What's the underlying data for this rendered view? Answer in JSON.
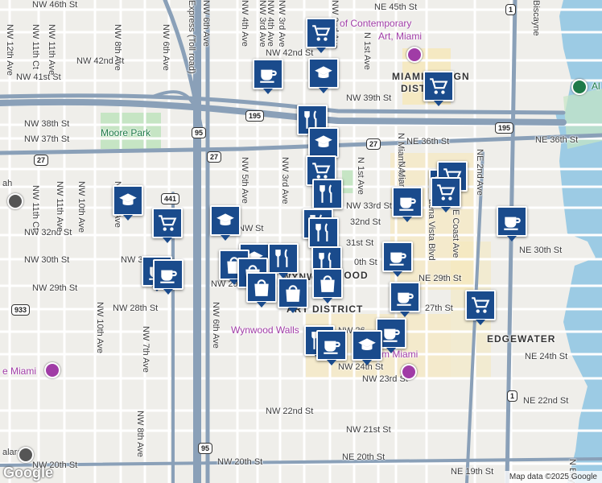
{
  "map": {
    "attribution": "Map data ©2025 Google",
    "logo": "Google",
    "labels": [
      {
        "id": "nw46",
        "text": "NW 46th St"
      },
      {
        "id": "nw42",
        "text": "NW 42nd St"
      },
      {
        "id": "nw41",
        "text": "NW 41st St"
      },
      {
        "id": "nw42b",
        "text": "NW 42nd St"
      },
      {
        "id": "nw38",
        "text": "NW 38th St"
      },
      {
        "id": "nw37",
        "text": "NW 37th St"
      },
      {
        "id": "nw39",
        "text": "NW 39th St"
      },
      {
        "id": "ne45",
        "text": "NE 45th St"
      },
      {
        "id": "ne36a",
        "text": "NE 36th St"
      },
      {
        "id": "ne36b",
        "text": "NE 36th St"
      },
      {
        "id": "nw32",
        "text": "NW 32nd St"
      },
      {
        "id": "nw30",
        "text": "NW 30th St"
      },
      {
        "id": "nw30b",
        "text": "NW 30"
      },
      {
        "id": "nw29",
        "text": "NW 29th St"
      },
      {
        "id": "nw29b",
        "text": "NW 29"
      },
      {
        "id": "nw28",
        "text": "NW 28th St"
      },
      {
        "id": "nw33",
        "text": "NW 33rd St"
      },
      {
        "id": "n32",
        "text": "32nd St"
      },
      {
        "id": "n31",
        "text": "31st St"
      },
      {
        "id": "n30",
        "text": "0th St"
      },
      {
        "id": "ne30",
        "text": "NE 30th St"
      },
      {
        "id": "ne29",
        "text": "NE 29th St"
      },
      {
        "id": "n27",
        "text": "27th St"
      },
      {
        "id": "ne24",
        "text": "NE 24th St"
      },
      {
        "id": "ne22",
        "text": "NE 22nd St"
      },
      {
        "id": "nw24",
        "text": "NW 24th St"
      },
      {
        "id": "nw23",
        "text": "NW 23rd St"
      },
      {
        "id": "nw22",
        "text": "NW 22nd St"
      },
      {
        "id": "nw21",
        "text": "NW 21st St"
      },
      {
        "id": "nw20",
        "text": "NW 20th St"
      },
      {
        "id": "nw20b",
        "text": "NW 20th St"
      },
      {
        "id": "ne20",
        "text": "NE 20th St"
      },
      {
        "id": "ne19",
        "text": "NE 19th St"
      },
      {
        "id": "nw26",
        "text": "NW 26"
      },
      {
        "id": "nwst",
        "text": "NW"
      },
      {
        "id": "nwst2",
        "text": "St"
      },
      {
        "id": "nw12",
        "text": "NW 12th Ave"
      },
      {
        "id": "nw11",
        "text": "NW 11th Ave"
      },
      {
        "id": "nw11ct",
        "text": "NW 11th Ct"
      },
      {
        "id": "nw11ct2",
        "text": "NW 11th Ct"
      },
      {
        "id": "nw11b",
        "text": "NW 11th Ave"
      },
      {
        "id": "nw10",
        "text": "NW 10th Ave"
      },
      {
        "id": "nw10b",
        "text": "NW 10th Ave"
      },
      {
        "id": "nw8",
        "text": "NW 8th Ave"
      },
      {
        "id": "nw8b",
        "text": "NW 8th Ave"
      },
      {
        "id": "nw8c",
        "text": "NW 8th Ave"
      },
      {
        "id": "nw7",
        "text": "NW 7th Ave"
      },
      {
        "id": "nw6",
        "text": "NW 6th Ave"
      },
      {
        "id": "nw6b",
        "text": "NW 6th Ave"
      },
      {
        "id": "nw5",
        "text": "NW 5th Ave"
      },
      {
        "id": "nw4",
        "text": "NW 4th Ave"
      },
      {
        "id": "nw3",
        "text": "NW 3rd Ave"
      },
      {
        "id": "nw3b",
        "text": "NW 3rd Ave"
      },
      {
        "id": "nw3c",
        "text": "NW 3rd Ave"
      },
      {
        "id": "n1",
        "text": "N 1st Ave"
      },
      {
        "id": "n1b",
        "text": "N 1st Ave"
      },
      {
        "id": "nmiami",
        "text": "N Miami Ave"
      },
      {
        "id": "nmiami2",
        "text": "N Miami A"
      },
      {
        "id": "ne2",
        "text": "NE 2nd Ave"
      },
      {
        "id": "ecoast",
        "text": "E Coast Ave"
      },
      {
        "id": "buena",
        "text": "Buena Vista Blvd"
      },
      {
        "id": "nebay",
        "text": "N Bayshore"
      },
      {
        "id": "biscayne",
        "text": "Biscayne"
      },
      {
        "id": "expr",
        "text": "Express (Toll road)"
      },
      {
        "id": "nw6top",
        "text": "NW 6th Ave"
      },
      {
        "id": "nw2",
        "text": "NW 2nd Ave"
      },
      {
        "id": "nw4b",
        "text": "NW 4th Ave"
      },
      {
        "id": "moore",
        "text": "Moore Park"
      },
      {
        "id": "wynwalls",
        "text": "Wynwood Walls"
      },
      {
        "id": "wynwood",
        "text": "WYNWOOD"
      },
      {
        "id": "wynart",
        "text": "ART DISTRICT"
      },
      {
        "id": "wyn2",
        "text": "WOOD"
      },
      {
        "id": "edgewater",
        "text": "EDGEWATER"
      },
      {
        "id": "design",
        "text": "MIAMI DESIGN"
      },
      {
        "id": "district",
        "text": "DISTRICT"
      },
      {
        "id": "ica1",
        "text": "ute of Contemporary"
      },
      {
        "id": "ica2",
        "text": "Art, Miami"
      },
      {
        "id": "rubell",
        "text": "m Miami"
      },
      {
        "id": "emiami",
        "text": "e Miami"
      },
      {
        "id": "alala",
        "text": "alara"
      },
      {
        "id": "ah",
        "text": "ah"
      },
      {
        "id": "alt",
        "text": "Al"
      }
    ],
    "shields": {
      "i195a": "195",
      "i195b": "195",
      "i95a": "95",
      "i95b": "95",
      "us27a": "27",
      "us27b": "27",
      "us27c": "27",
      "r441": "441",
      "r441b": "441",
      "r933": "933",
      "us1a": "1",
      "us1b": "1"
    },
    "markers": [
      {
        "id": "m1",
        "kind": "grocery"
      },
      {
        "id": "m2",
        "kind": "school"
      },
      {
        "id": "m3",
        "kind": "cafe"
      },
      {
        "id": "m4",
        "kind": "grocery"
      },
      {
        "id": "m5",
        "kind": "restaurant"
      },
      {
        "id": "m6",
        "kind": "school"
      },
      {
        "id": "m7",
        "kind": "grocery"
      },
      {
        "id": "m8",
        "kind": "restaurant"
      },
      {
        "id": "m9",
        "kind": "school"
      },
      {
        "id": "m10",
        "kind": "grocery"
      },
      {
        "id": "m11",
        "kind": "school"
      },
      {
        "id": "m12",
        "kind": "restaurant"
      },
      {
        "id": "m13",
        "kind": "restaurant"
      },
      {
        "id": "m14",
        "kind": "cafe"
      },
      {
        "id": "m15",
        "kind": "grocery"
      },
      {
        "id": "m16",
        "kind": "grocery"
      },
      {
        "id": "m17",
        "kind": "grocery"
      },
      {
        "id": "m18",
        "kind": "school"
      },
      {
        "id": "m19",
        "kind": "shopping"
      },
      {
        "id": "m20",
        "kind": "restaurant"
      },
      {
        "id": "m21",
        "kind": "cafe"
      },
      {
        "id": "m22",
        "kind": "restaurant"
      },
      {
        "id": "m23",
        "kind": "shopping"
      },
      {
        "id": "m24",
        "kind": "shopping"
      },
      {
        "id": "m25",
        "kind": "shopping"
      },
      {
        "id": "m26",
        "kind": "shopping"
      },
      {
        "id": "m27",
        "kind": "cafe"
      },
      {
        "id": "m28",
        "kind": "cafe"
      },
      {
        "id": "m29",
        "kind": "cafe"
      },
      {
        "id": "m30",
        "kind": "grocery"
      },
      {
        "id": "m31",
        "kind": "restaurant"
      },
      {
        "id": "m32",
        "kind": "cafe"
      },
      {
        "id": "m33",
        "kind": "school"
      },
      {
        "id": "m34",
        "kind": "cafe"
      },
      {
        "id": "m35",
        "kind": "cafe"
      }
    ],
    "colors": {
      "marker": "#1a4b8c",
      "water": "#9ccbe4",
      "highway": "#8aa0b8",
      "park": "#c6e5c4",
      "district": "#f6e7b8"
    }
  }
}
